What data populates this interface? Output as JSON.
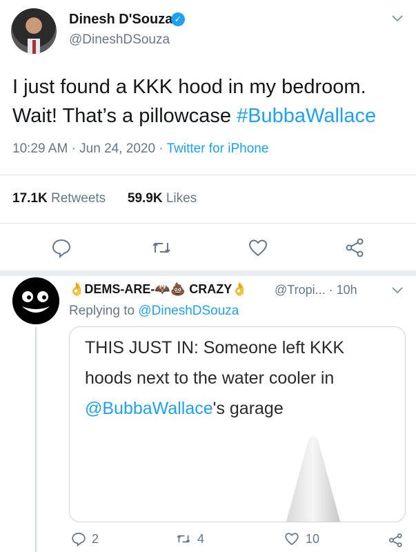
{
  "tweet": {
    "author_name": "Dinesh D'Souza",
    "author_handle": "@DineshDSouza",
    "text": "I just found a KKK hood in my bedroom. Wait! That’s a pillowcase",
    "hashtag": "#BubbaWallace",
    "timestamp": "10:29 AM · Jun 24, 2020 · ",
    "source": "Twitter for iPhone",
    "retweets_count": "17.1K",
    "retweets_label": "Retweets",
    "likes_count": "59.9K",
    "likes_label": "Likes"
  },
  "reply": {
    "author_name": "👌DEMS-ARE-🦇💩 CRAZY👌",
    "author_handle": "@Tropi... · 10h",
    "replying_prefix": "Replying to ",
    "replying_to": "@DineshDSouza",
    "card_line1": "THIS JUST IN: Someone left KKK hoods next to the water cooler in",
    "card_mention": "@BubbaWallace",
    "card_suffix": "'s garage",
    "reply_count": "2",
    "retweet_count": "4",
    "like_count": "10"
  },
  "icons": {
    "verified": "verified-badge-icon",
    "chevron": "chevron-down-icon",
    "reply": "reply-icon",
    "retweet": "retweet-icon",
    "like": "heart-icon",
    "share": "share-icon"
  },
  "colors": {
    "accent": "#1da1f2",
    "muted": "#657786",
    "divider": "#e1e8ed"
  }
}
